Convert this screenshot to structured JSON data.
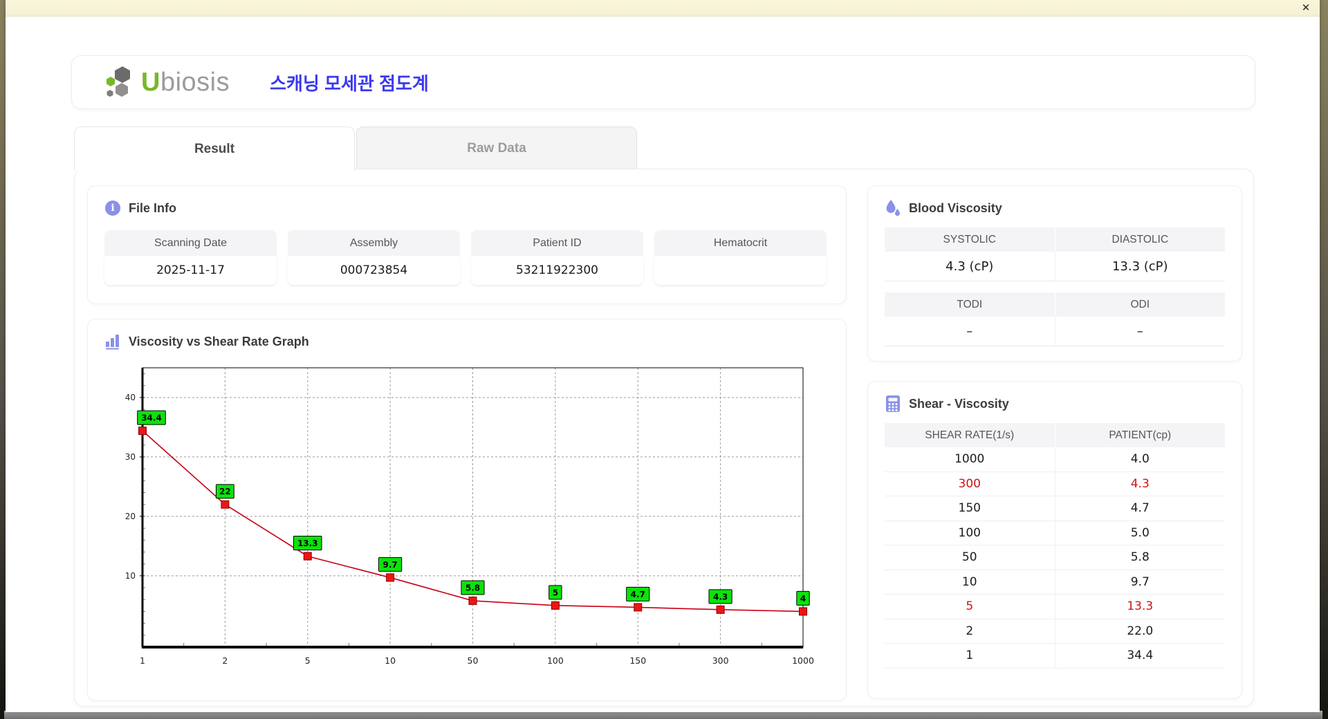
{
  "window": {
    "close_label": "✕"
  },
  "colors": {
    "accent_periwinkle": "#8a91e8",
    "title_blue": "#3939f0",
    "logo_green": "#76b82a",
    "logo_gray": "#9b9b9b",
    "highlight_red": "#cc1414",
    "chart_line": "#c80016",
    "chart_marker": "#ed1515",
    "chart_label_green": "#0be30b",
    "titlebar_cream": "#f7f3da"
  },
  "icons": {
    "close": "close-icon",
    "file_info": "info-icon",
    "blood": "droplets-icon",
    "graph": "bar-chart-icon",
    "shear": "calculator-icon",
    "logo": "hexagon-cluster-logo"
  },
  "header": {
    "logo_u": "U",
    "logo_rest": "biosis",
    "title": "스캐닝 모세관 점도계"
  },
  "tabs": [
    {
      "label": "Result",
      "active": true
    },
    {
      "label": "Raw Data",
      "active": false
    }
  ],
  "file_info": {
    "title": "File Info",
    "fields": [
      {
        "label": "Scanning Date",
        "value": "2025-11-17"
      },
      {
        "label": "Assembly",
        "value": "000723854"
      },
      {
        "label": "Patient ID",
        "value": "53211922300"
      },
      {
        "label": "Hematocrit",
        "value": ""
      }
    ]
  },
  "blood_viscosity": {
    "title": "Blood Viscosity",
    "groups": [
      {
        "headers": [
          "SYSTOLIC",
          "DIASTOLIC"
        ],
        "values": [
          "4.3 (cP)",
          "13.3 (cP)"
        ]
      },
      {
        "headers": [
          "TODI",
          "ODI"
        ],
        "values": [
          "–",
          "–"
        ]
      }
    ]
  },
  "graph": {
    "title": "Viscosity vs Shear Rate Graph"
  },
  "chart_data": {
    "type": "line",
    "title": "Viscosity vs Shear Rate Graph",
    "x_labels": [
      "1",
      "2",
      "5",
      "10",
      "50",
      "100",
      "150",
      "300",
      "1000"
    ],
    "x_values": [
      1,
      2,
      5,
      10,
      50,
      100,
      150,
      300,
      1000
    ],
    "values": [
      34.4,
      22,
      13.3,
      9.7,
      5.8,
      5,
      4.7,
      4.3,
      4
    ],
    "point_labels": [
      "34.4",
      "22",
      "13.3",
      "9.7",
      "5.8",
      "5",
      "4.7",
      "4.3",
      "4"
    ],
    "yticks": [
      10,
      20,
      30,
      40
    ],
    "ymin": -2,
    "ymax": 45,
    "x_scale": "categorical-log-like",
    "grid": "dashed",
    "legend": "none",
    "line_color": "#c80016",
    "marker": "red-square",
    "label_style": "green-box-black-border"
  },
  "shear_table": {
    "title": "Shear - Viscosity",
    "columns": [
      "SHEAR RATE(1/s)",
      "PATIENT(cp)"
    ],
    "rows": [
      {
        "shear": "1000",
        "patient": "4.0",
        "highlight": false
      },
      {
        "shear": "300",
        "patient": "4.3",
        "highlight": true
      },
      {
        "shear": "150",
        "patient": "4.7",
        "highlight": false
      },
      {
        "shear": "100",
        "patient": "5.0",
        "highlight": false
      },
      {
        "shear": "50",
        "patient": "5.8",
        "highlight": false
      },
      {
        "shear": "10",
        "patient": "9.7",
        "highlight": false
      },
      {
        "shear": "5",
        "patient": "13.3",
        "highlight": true
      },
      {
        "shear": "2",
        "patient": "22.0",
        "highlight": false
      },
      {
        "shear": "1",
        "patient": "34.4",
        "highlight": false
      }
    ]
  }
}
